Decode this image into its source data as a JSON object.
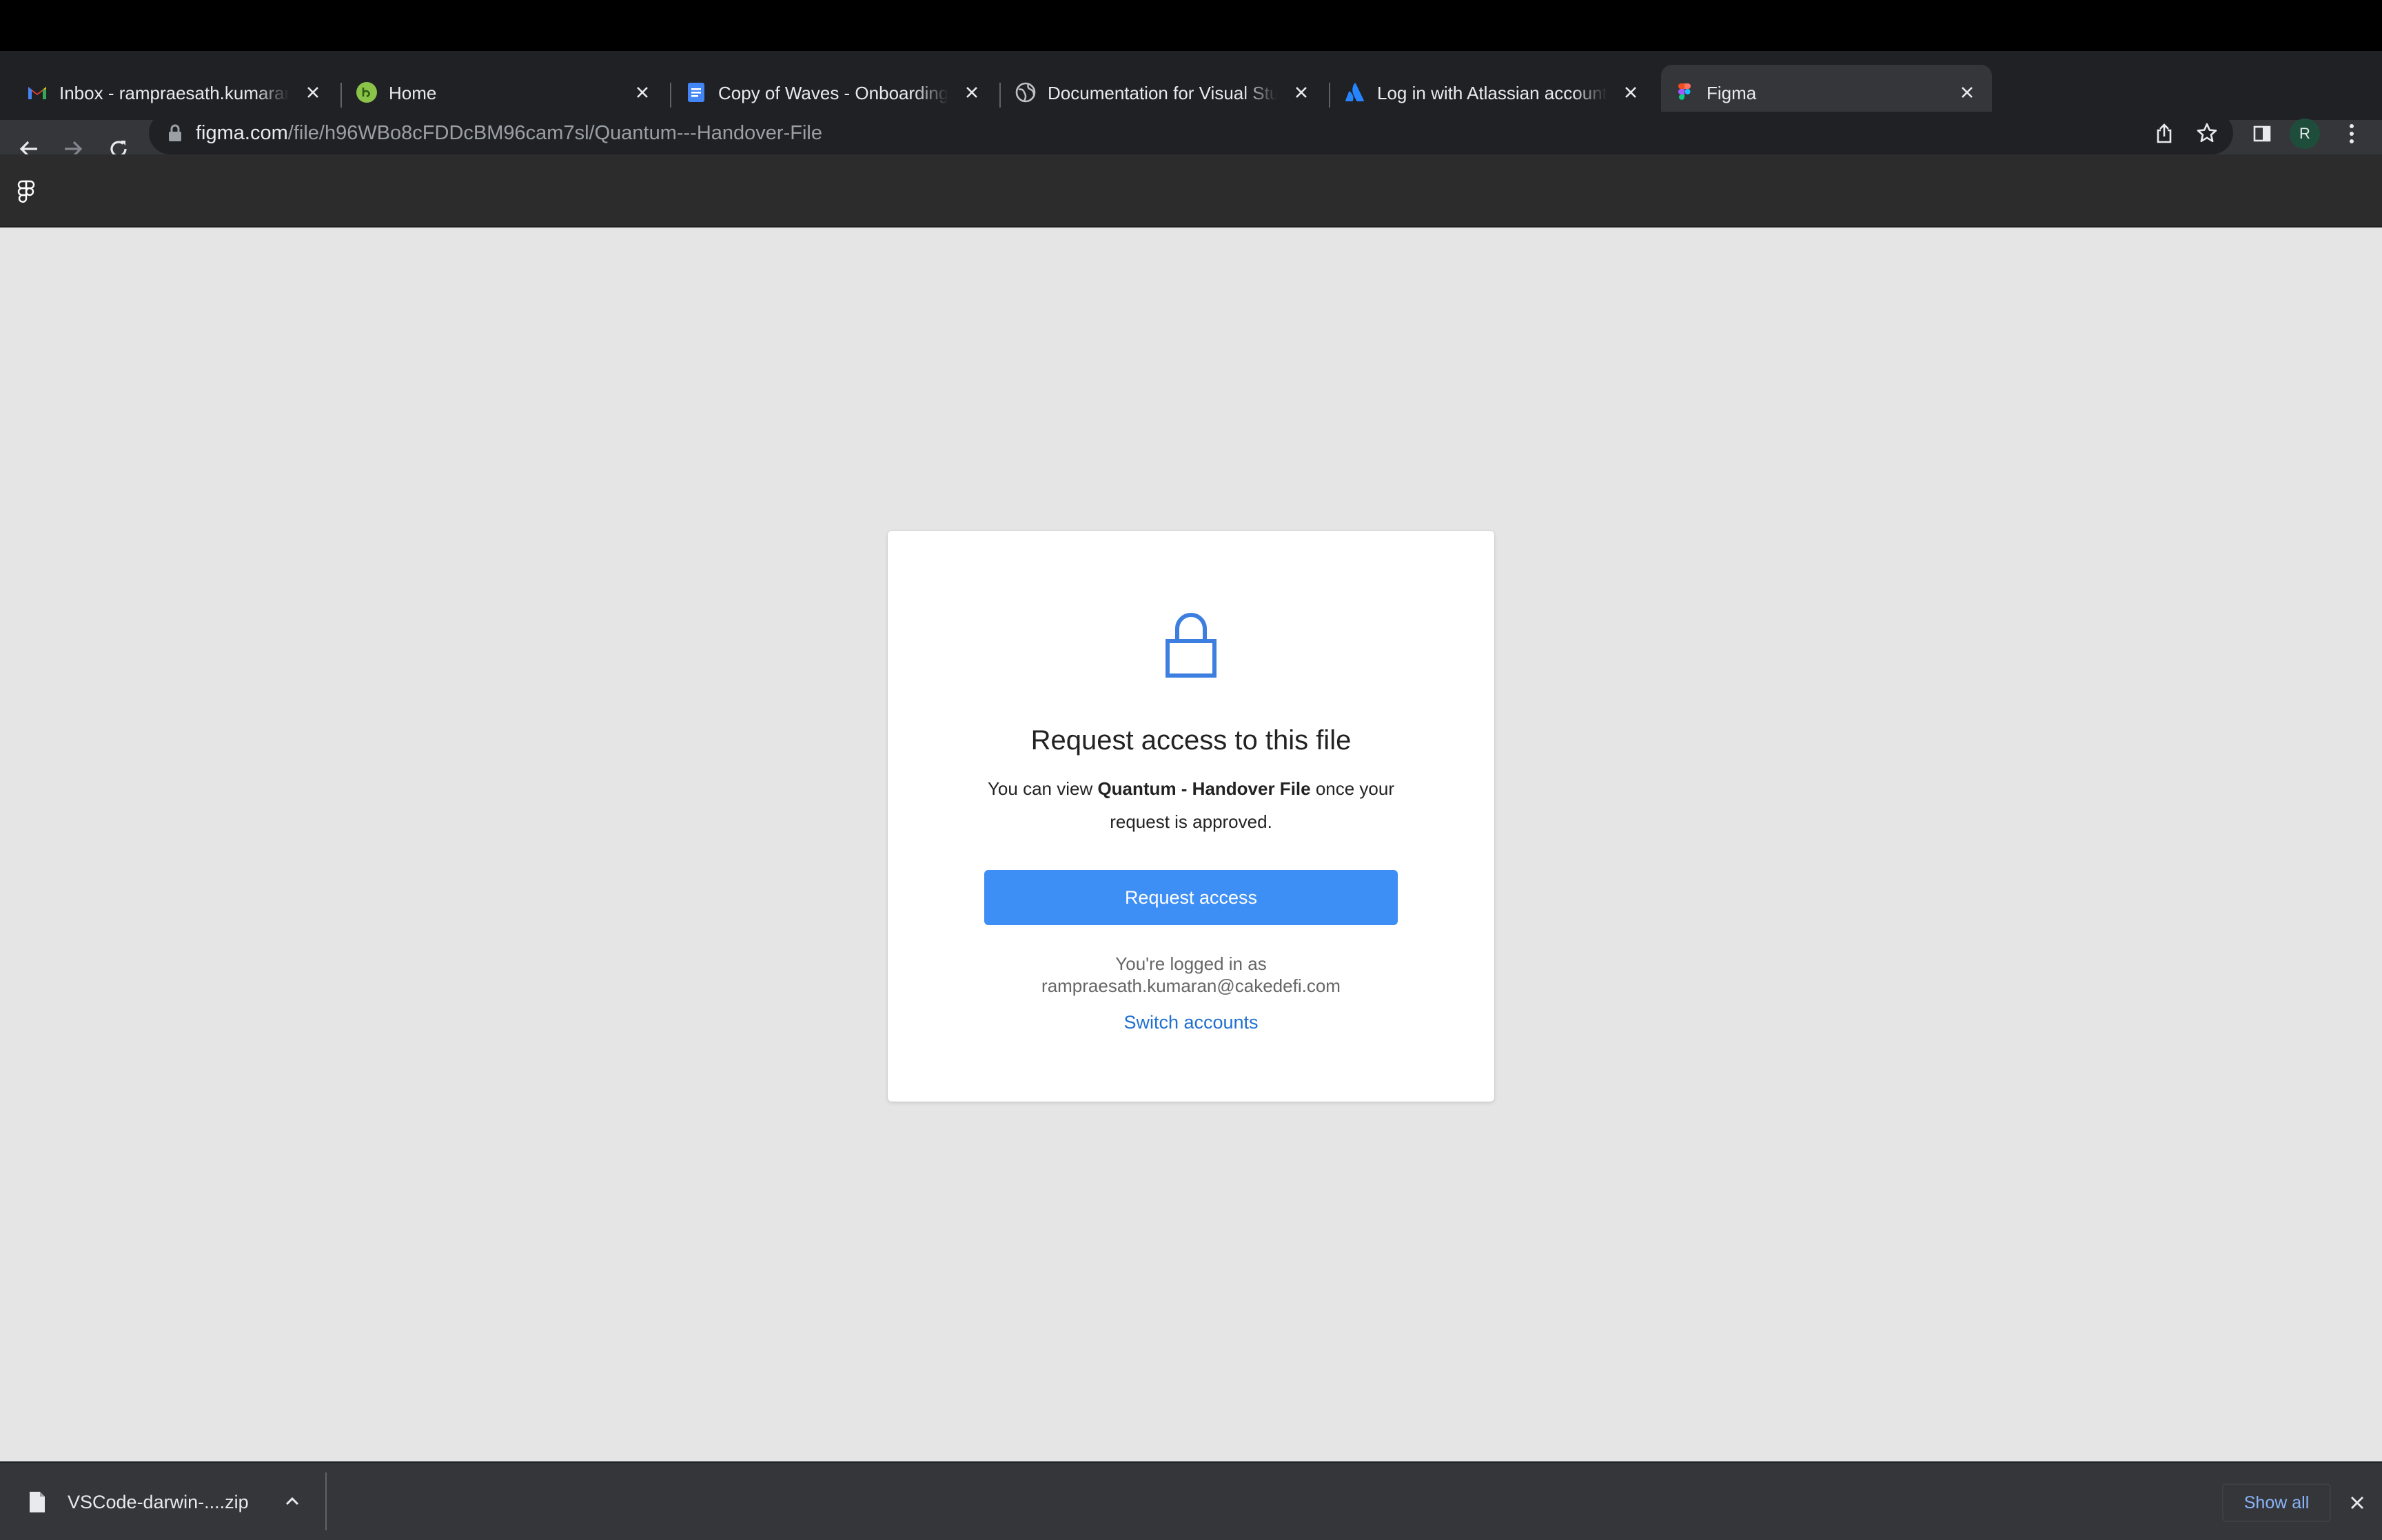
{
  "browser": {
    "tabs": [
      {
        "title": "Inbox - rampraesath.kumaran@",
        "icon": "gmail-icon"
      },
      {
        "title": "Home",
        "icon": "green-app-icon"
      },
      {
        "title": "Copy of Waves - Onboarding D",
        "icon": "google-docs-icon"
      },
      {
        "title": "Documentation for Visual Studi",
        "icon": "globe-icon"
      },
      {
        "title": "Log in with Atlassian account",
        "icon": "atlassian-icon"
      },
      {
        "title": "Figma",
        "icon": "figma-icon",
        "active": true
      }
    ],
    "address": {
      "host": "figma.com",
      "path": "/file/h96WBo8cFDDcBM96cam7sl/Quantum---Handover-File"
    },
    "profile_initial": "R"
  },
  "dialog": {
    "title": "Request access to this file",
    "desc_prefix": "You can view ",
    "file_name": "Quantum - Handover File",
    "desc_suffix": " once your request is approved.",
    "request_button": "Request access",
    "logged_in_label": "You're logged in as",
    "email": "rampraesath.kumaran@cakedefi.com",
    "switch_accounts": "Switch accounts"
  },
  "downloads": {
    "file_name": "VSCode-darwin-....zip",
    "show_all": "Show all"
  },
  "colors": {
    "accent": "#3d8ef5",
    "link": "#1f6fd1",
    "lock_icon": "#3d7fe0"
  }
}
